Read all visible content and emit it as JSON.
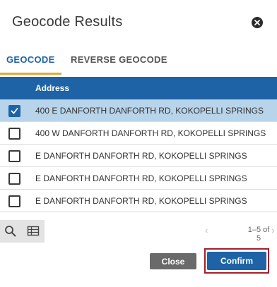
{
  "dialog": {
    "title": "Geocode Results",
    "close_icon": "close-icon"
  },
  "tabs": [
    {
      "label": "GEOCODE",
      "active": true
    },
    {
      "label": "REVERSE GEOCODE",
      "active": false
    }
  ],
  "table": {
    "header": {
      "address": "Address"
    },
    "rows": [
      {
        "address": "400 E DANFORTH DANFORTH RD, KOKOPELLI SPRINGS",
        "checked": true
      },
      {
        "address": "400 W DANFORTH DANFORTH RD, KOKOPELLI SPRINGS",
        "checked": false
      },
      {
        "address": "E DANFORTH DANFORTH RD, KOKOPELLI SPRINGS",
        "checked": false
      },
      {
        "address": "E DANFORTH DANFORTH RD, KOKOPELLI SPRINGS",
        "checked": false
      },
      {
        "address": "E DANFORTH DANFORTH RD, KOKOPELLI SPRINGS",
        "checked": false
      }
    ]
  },
  "toolbar": {
    "search_icon": "search-icon",
    "table_icon": "table-icon"
  },
  "pager": {
    "range": "1–5 of 5"
  },
  "buttons": {
    "close": "Close",
    "confirm": "Confirm"
  },
  "colors": {
    "accent": "#1e63a6",
    "selected_row": "#b8d4ea",
    "tab_underline": "#e0a93b",
    "highlight_frame": "#a31f2a"
  }
}
